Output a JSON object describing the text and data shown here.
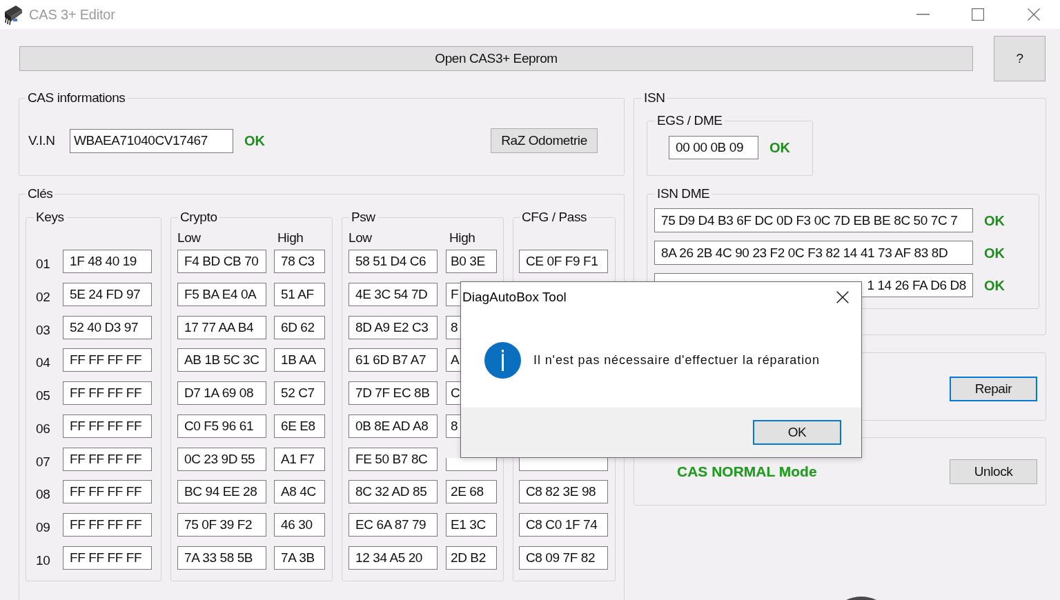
{
  "window": {
    "title": "CAS 3+ Editor"
  },
  "toolbar": {
    "open_button": "Open CAS3+ Eeprom",
    "help_button": "?"
  },
  "cas_info": {
    "title": "CAS informations",
    "vin_label": "V.I.N",
    "vin": "WBAEA71040CV17467",
    "vin_status": "OK",
    "odometer_button": "RaZ Odometrie"
  },
  "cles": {
    "title": "Clés",
    "keys": {
      "title": "Keys",
      "rows": [
        {
          "number": "01",
          "value": "1F 48 40 19"
        },
        {
          "number": "02",
          "value": "5E 24 FD 97"
        },
        {
          "number": "03",
          "value": "52 40 D3 97"
        },
        {
          "number": "04",
          "value": "FF FF FF FF"
        },
        {
          "number": "05",
          "value": "FF FF FF FF"
        },
        {
          "number": "06",
          "value": "FF FF FF FF"
        },
        {
          "number": "07",
          "value": "FF FF FF FF"
        },
        {
          "number": "08",
          "value": "FF FF FF FF"
        },
        {
          "number": "09",
          "value": "FF FF FF FF"
        },
        {
          "number": "10",
          "value": "FF FF FF FF"
        }
      ]
    },
    "crypto": {
      "title": "Crypto",
      "low_label": "Low",
      "high_label": "High",
      "rows": [
        {
          "low": "F4 BD CB 70",
          "high": "78 C3"
        },
        {
          "low": "F5 BA E4 0A",
          "high": "51 AF"
        },
        {
          "low": "17 77 AA B4",
          "high": "6D 62"
        },
        {
          "low": "AB 1B 5C 3C",
          "high": "1B AA"
        },
        {
          "low": "D7 1A 69 08",
          "high": "52 C7"
        },
        {
          "low": "C0 F5 96 61",
          "high": "6E E8"
        },
        {
          "low": "0C 23 9D 55",
          "high": "A1 F7"
        },
        {
          "low": "BC 94 EE 28",
          "high": "A8 4C"
        },
        {
          "low": "75 0F 39 F2",
          "high": "46 30"
        },
        {
          "low": "7A 33 58 5B",
          "high": "7A 3B"
        }
      ]
    },
    "psw": {
      "title": "Psw",
      "low_label": "Low",
      "high_label": "High",
      "rows": [
        {
          "low": "58 51 D4 C6",
          "high": "B0 3E"
        },
        {
          "low": "4E 3C 54 7D",
          "high": "F"
        },
        {
          "low": "8D A9 E2 C3",
          "high": "8"
        },
        {
          "low": "61 6D B7 A7",
          "high": "A"
        },
        {
          "low": "7D 7F EC 8B",
          "high": "C"
        },
        {
          "low": "0B 8E AD A8",
          "high": "8"
        },
        {
          "low": "FE 50 B7 8C"
        },
        {
          "low": "8C 32 AD 85",
          "high": "2E 68"
        },
        {
          "low": "EC 6A 87 79",
          "high": "E1 3C"
        },
        {
          "low": "12 34 A5 20",
          "high": "2D B2"
        }
      ]
    },
    "cfg_pass": {
      "title": "CFG / Pass",
      "rows": [
        {
          "value": "CE 0F F9 F1"
        },
        null,
        null,
        null,
        null,
        null,
        {},
        {
          "value": "C8 82 3E 98"
        },
        {
          "value": "C8 C0 1F 74"
        },
        {
          "value": "C8 09 7F 82"
        }
      ]
    }
  },
  "isn": {
    "title": "ISN",
    "egs_dme": {
      "title": "EGS / DME",
      "value": "00 00 0B 09",
      "status": "OK"
    },
    "isn_dme": {
      "title": "ISN DME",
      "rows": [
        {
          "value": "75 D9 D4 B3 6F DC 0D F3 0C 7D EB BE 8C 50 7C 7",
          "status": "OK",
          "obscured": false
        },
        {
          "value": "8A 26 2B 4C 90 23 F2 0C F3 82 14 41 73 AF 83 8D",
          "status": "OK",
          "obscured": false
        },
        {
          "value": "1 14 26 FA D6 D8",
          "status": "OK",
          "obscured": true
        }
      ]
    }
  },
  "repair": {
    "button": {
      "label": "Repair",
      "focused": true
    }
  },
  "mode": {
    "label": "CAS NORMAL Mode",
    "unlock_button": {
      "label": "Unlock",
      "focused": false
    }
  },
  "dialog": {
    "title": "DiagAutoBox Tool",
    "message": "Il n'est pas nécessaire d'effectuer la réparation",
    "ok_button": {
      "label": "OK",
      "focused": true
    }
  }
}
